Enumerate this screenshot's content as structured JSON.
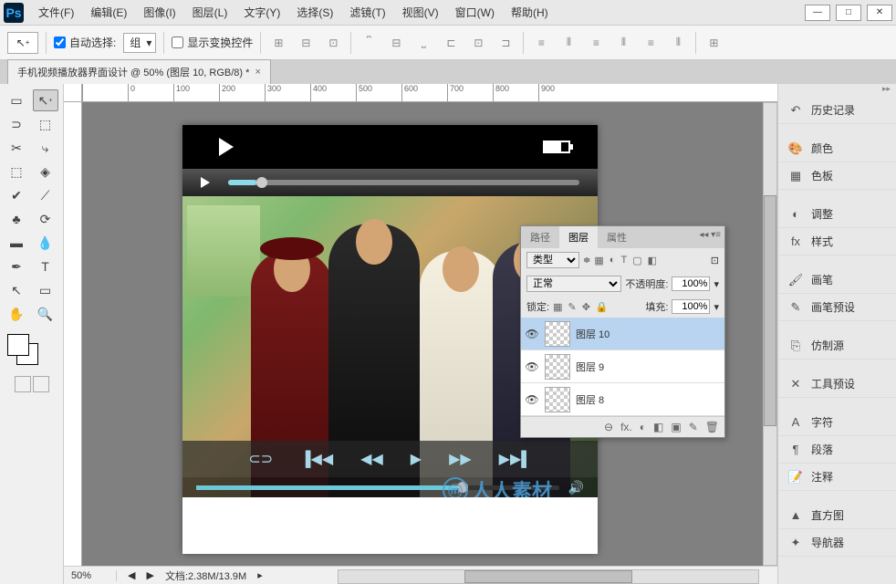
{
  "app": {
    "logo": "Ps"
  },
  "menu": [
    "文件(F)",
    "编辑(E)",
    "图像(I)",
    "图层(L)",
    "文字(Y)",
    "选择(S)",
    "滤镜(T)",
    "视图(V)",
    "窗口(W)",
    "帮助(H)"
  ],
  "window_controls": {
    "min": "—",
    "max": "□",
    "close": "✕"
  },
  "options": {
    "auto_select": "自动选择:",
    "group": "组",
    "show_transform": "显示变换控件"
  },
  "tab": {
    "title": "手机视频播放器界面设计 @ 50% (图层 10, RGB/8) *"
  },
  "ruler_marks": [
    "0",
    "100",
    "200",
    "300",
    "400",
    "500",
    "600",
    "700",
    "800",
    "900"
  ],
  "layers_panel": {
    "tabs": [
      "路径",
      "图层",
      "属性"
    ],
    "kind_label": "类型",
    "blend": "正常",
    "opacity_label": "不透明度:",
    "opacity": "100%",
    "lock_label": "锁定:",
    "fill_label": "填充:",
    "fill": "100%",
    "items": [
      {
        "name": "图层 10",
        "selected": true
      },
      {
        "name": "图层 9",
        "selected": false
      },
      {
        "name": "图层 8",
        "selected": false
      }
    ],
    "footer_icons": [
      "⊖",
      "fx.",
      "◐",
      "◧",
      "▣",
      "✎",
      "🗑"
    ]
  },
  "right_panels": [
    {
      "icon": "↶",
      "label": "历史记录"
    },
    {
      "icon": "🎨",
      "label": "颜色"
    },
    {
      "icon": "▦",
      "label": "色板"
    },
    {
      "icon": "◐",
      "label": "调整"
    },
    {
      "icon": "fx",
      "label": "样式"
    },
    {
      "icon": "🖌",
      "label": "画笔"
    },
    {
      "icon": "✎",
      "label": "画笔预设"
    },
    {
      "icon": "⎘",
      "label": "仿制源"
    },
    {
      "icon": "✕",
      "label": "工具预设"
    },
    {
      "icon": "A",
      "label": "字符"
    },
    {
      "icon": "¶",
      "label": "段落"
    },
    {
      "icon": "📝",
      "label": "注释"
    },
    {
      "icon": "▲",
      "label": "直方图"
    },
    {
      "icon": "✦",
      "label": "导航器"
    }
  ],
  "status": {
    "zoom": "50%",
    "doc": "文档:2.38M/13.9M"
  },
  "watermark": {
    "logo": "ⓜ",
    "text": "人人素材"
  },
  "tools": [
    "▭",
    "↖",
    "⬚",
    "◰",
    "↯",
    "⌖",
    "✂",
    "✎",
    "⬚",
    "◆",
    "✔",
    "⟋",
    "⟋",
    "⬤",
    "✎",
    "◉",
    "✒",
    "T",
    "↖",
    "▭",
    "✋",
    "🔍"
  ]
}
